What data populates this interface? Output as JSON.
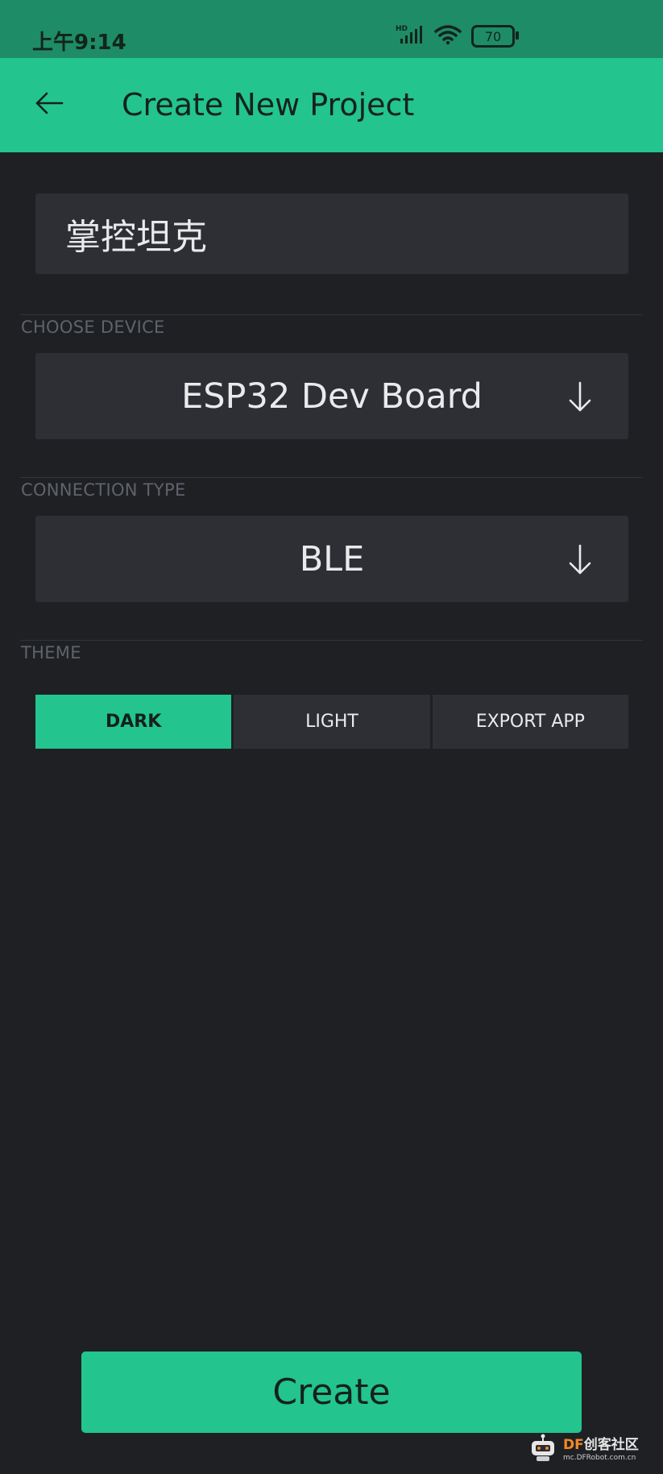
{
  "status_bar": {
    "time": "上午9:14",
    "hd_label": "HD",
    "battery_level": "70",
    "icons": [
      "signal-icon",
      "wifi-icon",
      "battery-icon"
    ]
  },
  "header": {
    "title": "Create New Project",
    "back_icon": "arrow-left-icon"
  },
  "project": {
    "name": "掌控坦克"
  },
  "device": {
    "section_label": "CHOOSE DEVICE",
    "selected": "ESP32 Dev Board",
    "arrow_icon": "arrow-down-icon"
  },
  "connection": {
    "section_label": "CONNECTION TYPE",
    "selected": "BLE",
    "arrow_icon": "arrow-down-icon"
  },
  "theme": {
    "section_label": "THEME",
    "options": [
      "DARK",
      "LIGHT",
      "EXPORT APP"
    ],
    "active": "DARK"
  },
  "actions": {
    "create_label": "Create"
  },
  "watermark": {
    "brand_prefix": "DF",
    "brand_suffix": "创客社区",
    "url": "mc.DFRobot.com.cn"
  },
  "colors": {
    "accent": "#23c48e",
    "status_bar": "#1e8c66",
    "background": "#1f2024",
    "field": "#2e2f34",
    "label": "#5f636b",
    "text": "#e9eaec"
  }
}
